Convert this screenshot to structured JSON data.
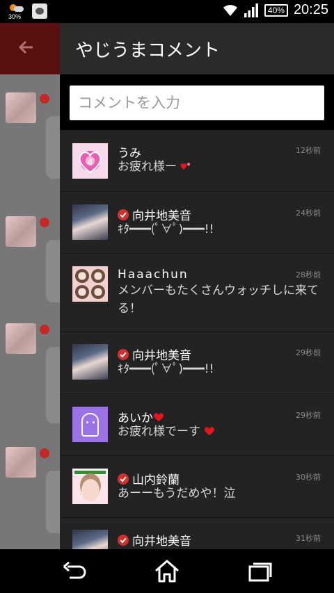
{
  "status_bar": {
    "weather_percent": "30%",
    "battery": "40%",
    "time": "20:25",
    "icons": [
      "weather-icon",
      "notification-app-icon",
      "wifi-icon",
      "signal-icon",
      "battery-icon"
    ]
  },
  "background_app": {
    "toolbar_icon": "back-arrow-icon",
    "accent_color": "#5a1010"
  },
  "drawer": {
    "title": "やじうまコメント",
    "input_placeholder": "コメントを入力",
    "comments": [
      {
        "name": "うみ",
        "verified": false,
        "time": "12秒前",
        "message": "お疲れ様ー",
        "trailing_icon": "hearts-icon",
        "avatar": "heart-emblem"
      },
      {
        "name": "向井地美音",
        "verified": true,
        "time": "24秒前",
        "message": "ｷﾀ━━━(ﾟ∀ﾟ)━━━!!",
        "avatar": "photo"
      },
      {
        "name": "Haaachun",
        "verified": false,
        "time": "28秒前",
        "message": "メンバーもたくさんウォッチしに来てる！",
        "avatar": "collage"
      },
      {
        "name": "向井地美音",
        "verified": true,
        "time": "29秒前",
        "message": "ｷﾀ━━━(ﾟ∀ﾟ)━━━!!",
        "avatar": "photo"
      },
      {
        "name": "あいか",
        "name_icon": "heart-icon",
        "verified": false,
        "time": "29秒前",
        "message": "お疲れ様でーす",
        "trailing_icon": "heart-icon",
        "avatar": "ghost"
      },
      {
        "name": "山内鈴蘭",
        "verified": true,
        "time": "30秒前",
        "message": "あーーもうだめや！泣",
        "avatar": "photo"
      },
      {
        "name": "向井地美音",
        "verified": true,
        "time": "31秒前",
        "message": "",
        "avatar": "photo"
      }
    ]
  },
  "nav_bar": {
    "icons": [
      "back-icon",
      "home-icon",
      "recent-apps-icon"
    ]
  },
  "colors": {
    "drawer_bg": "#232323",
    "verified_red": "#d32f2f",
    "heart_red": "#e8141e"
  }
}
